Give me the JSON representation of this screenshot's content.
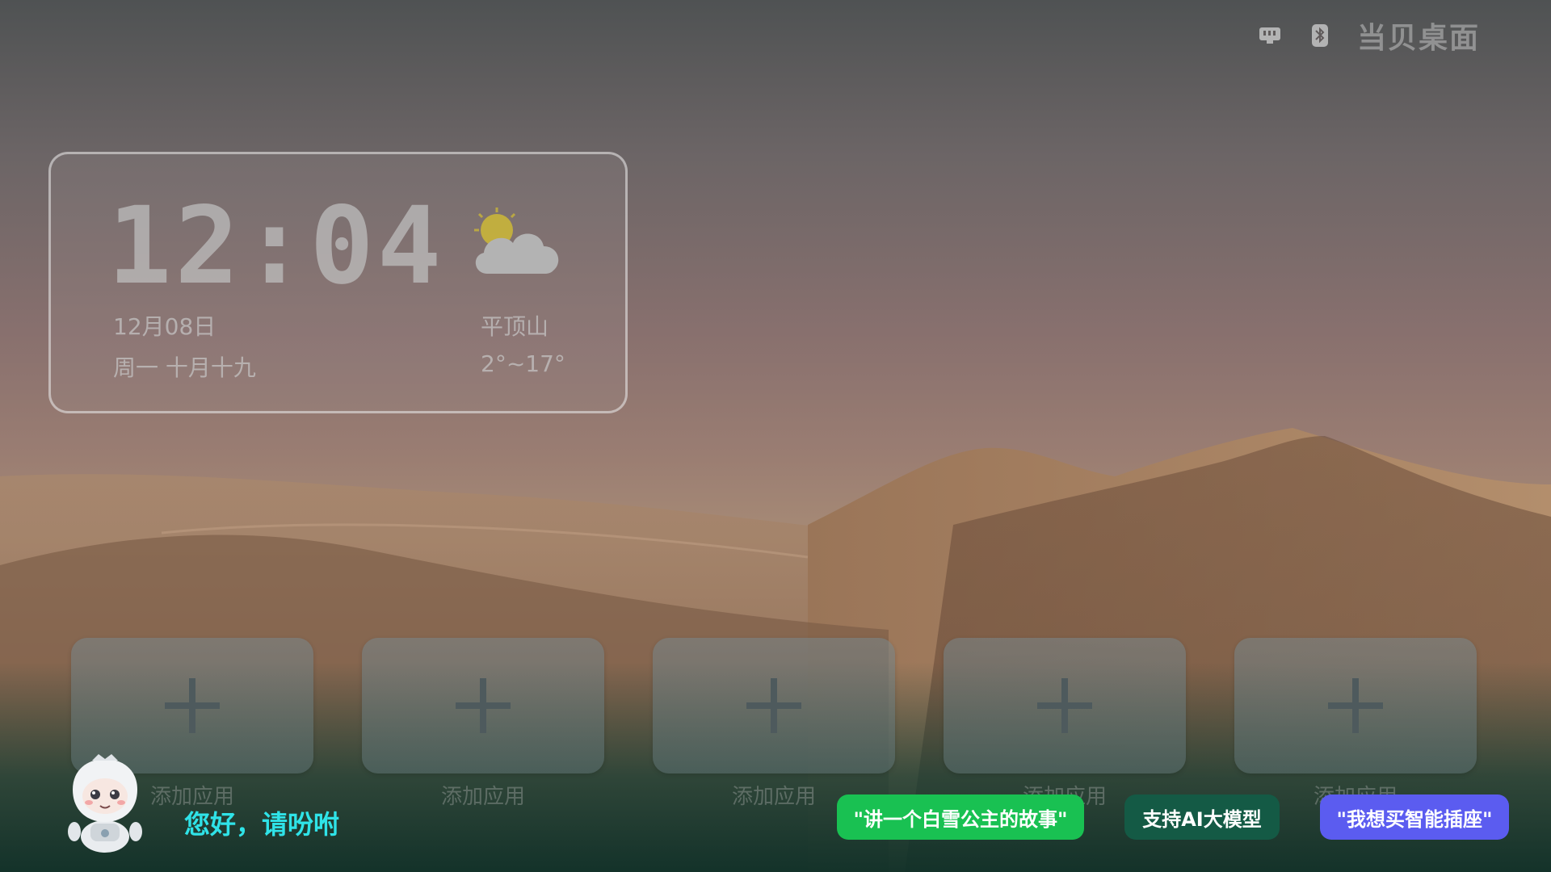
{
  "status_bar": {
    "brand": "当贝桌面",
    "icons": [
      "ethernet-icon",
      "bluetooth-icon"
    ]
  },
  "clock_widget": {
    "time": "12:04",
    "date": "12月08日",
    "lunar": "周一  十月十九",
    "city": "平顶山",
    "temp_range": "2°~17°",
    "weather_icon": "partly-cloudy-icon"
  },
  "tiles": [
    {
      "label": "添加应用"
    },
    {
      "label": "添加应用"
    },
    {
      "label": "添加应用"
    },
    {
      "label": "添加应用"
    },
    {
      "label": "添加应用"
    }
  ],
  "assistant": {
    "greeting": "您好，请吩咐",
    "chips": [
      {
        "label": "\"讲一个白雪公主的故事\"",
        "color": "#19c152"
      },
      {
        "label": "支持AI大模型",
        "color": "#145a45"
      },
      {
        "label": "\"我想买智能插座\"",
        "color": "#5b5cf0"
      }
    ]
  },
  "colors": {
    "greeting_accent": "#2fe3e8"
  }
}
